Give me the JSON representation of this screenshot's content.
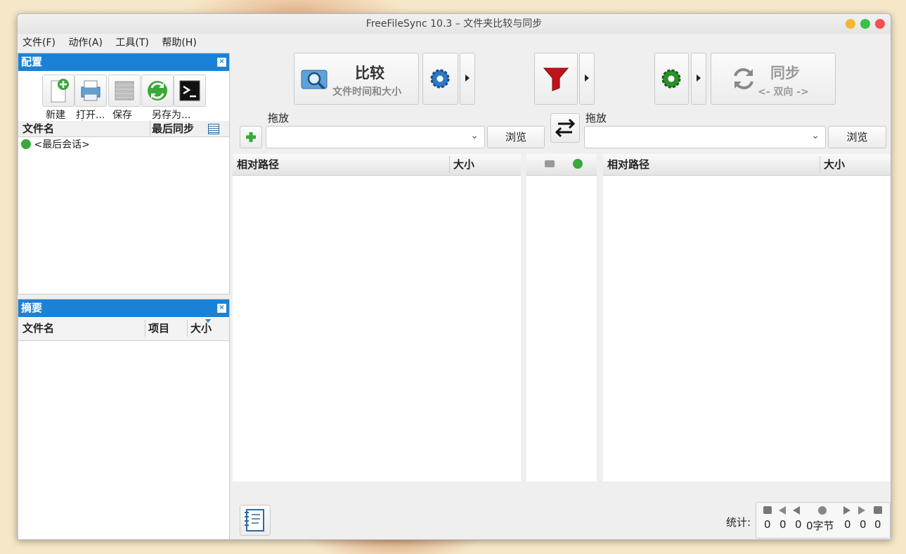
{
  "window": {
    "title": "FreeFileSync 10.3 – 文件夹比较与同步"
  },
  "menu": [
    "文件(F)",
    "动作(A)",
    "工具(T)",
    "帮助(H)"
  ],
  "config_panel": {
    "title": "配置",
    "toolbar": {
      "new": "新建",
      "open": "打开...",
      "save": "保存",
      "save_as": "另存为..."
    },
    "columns": {
      "name": "文件名",
      "last_sync": "最后同步"
    },
    "items": [
      "<最后会话>"
    ]
  },
  "summary_panel": {
    "title": "摘要",
    "columns": {
      "name": "文件名",
      "items": "项目",
      "size": "大小"
    }
  },
  "actions": {
    "compare": {
      "label": "比较",
      "sub": "文件时间和大小"
    },
    "sync": {
      "label": "同步",
      "sub": "<- 双向 ->"
    }
  },
  "folders": {
    "left": {
      "drop_label": "拖放",
      "value": "",
      "browse": "浏览"
    },
    "right": {
      "drop_label": "拖放",
      "value": "",
      "browse": "浏览"
    }
  },
  "grid": {
    "left": {
      "col_path": "相对路径",
      "col_size": "大小"
    },
    "right": {
      "col_path": "相对路径",
      "col_size": "大小"
    }
  },
  "stats": {
    "label": "统计:",
    "values": [
      "0",
      "0",
      "0",
      "0字节",
      "0",
      "0",
      "0"
    ]
  },
  "colors": {
    "accent": "#1a82d6",
    "filter_red": "#c0141a",
    "gear_blue": "#2b78c8",
    "gear_green": "#2d8f2a"
  }
}
